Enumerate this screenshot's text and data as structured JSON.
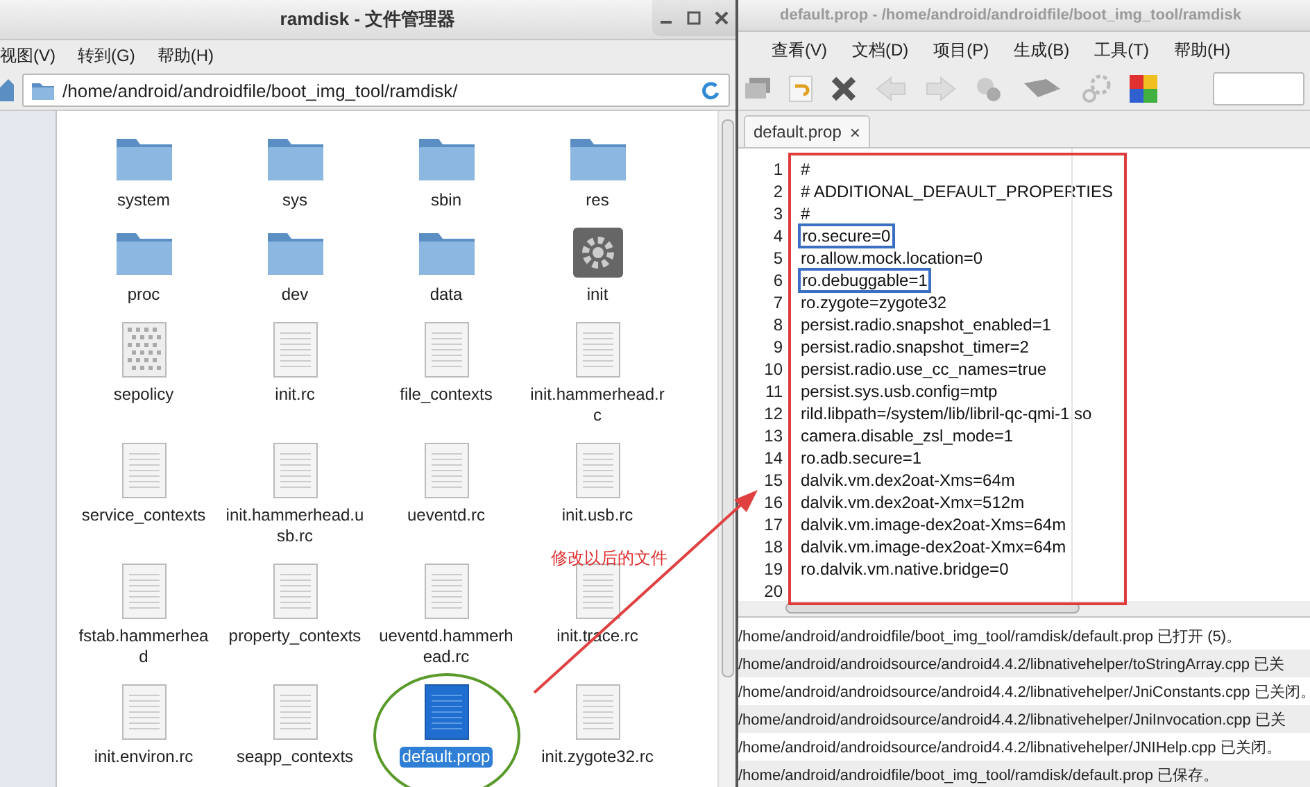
{
  "file_manager": {
    "title": "ramdisk - 文件管理器",
    "menu": [
      "视图(V)",
      "转到(G)",
      "帮助(H)"
    ],
    "path": "/home/android/androidfile/boot_img_tool/ramdisk/",
    "files": [
      {
        "name": "system",
        "kind": "folder",
        "selected": false
      },
      {
        "name": "sys",
        "kind": "folder",
        "selected": false
      },
      {
        "name": "sbin",
        "kind": "folder",
        "selected": false
      },
      {
        "name": "res",
        "kind": "folder",
        "selected": false
      },
      {
        "name": "proc",
        "kind": "folder",
        "selected": false
      },
      {
        "name": "dev",
        "kind": "folder",
        "selected": false
      },
      {
        "name": "data",
        "kind": "folder",
        "selected": false
      },
      {
        "name": "init",
        "kind": "program",
        "selected": false
      },
      {
        "name": "sepolicy",
        "kind": "binary",
        "selected": false
      },
      {
        "name": "init.rc",
        "kind": "text",
        "selected": false
      },
      {
        "name": "file_contexts",
        "kind": "text",
        "selected": false
      },
      {
        "name": "init.hammerhead.rc",
        "kind": "text",
        "selected": false
      },
      {
        "name": "service_contexts",
        "kind": "text",
        "selected": false
      },
      {
        "name": "init.hammerhead.usb.rc",
        "kind": "text",
        "selected": false
      },
      {
        "name": "ueventd.rc",
        "kind": "text",
        "selected": false
      },
      {
        "name": "init.usb.rc",
        "kind": "text",
        "selected": false
      },
      {
        "name": "fstab.hammerhead",
        "kind": "text",
        "selected": false
      },
      {
        "name": "property_contexts",
        "kind": "text",
        "selected": false
      },
      {
        "name": "ueventd.hammerhead.rc",
        "kind": "text",
        "selected": false
      },
      {
        "name": "init.trace.rc",
        "kind": "text",
        "selected": false
      },
      {
        "name": "init.environ.rc",
        "kind": "text",
        "selected": false
      },
      {
        "name": "seapp_contexts",
        "kind": "text",
        "selected": false
      },
      {
        "name": "default.prop",
        "kind": "text",
        "selected": true
      },
      {
        "name": "init.zygote32.rc",
        "kind": "text",
        "selected": false
      }
    ],
    "annotation": "修改以后的文件"
  },
  "editor": {
    "title": "default.prop - /home/android/androidfile/boot_img_tool/ramdisk",
    "menu": [
      "查看(V)",
      "文档(D)",
      "项目(P)",
      "生成(B)",
      "工具(T)",
      "帮助(H)"
    ],
    "tab": {
      "label": "default.prop",
      "close": "×"
    },
    "lines": [
      {
        "number": "1",
        "text": "#",
        "boxed": false
      },
      {
        "number": "2",
        "text": "# ADDITIONAL_DEFAULT_PROPERTIES",
        "boxed": false
      },
      {
        "number": "3",
        "text": "#",
        "boxed": false
      },
      {
        "number": "4",
        "text": "ro.secure=0",
        "boxed": true
      },
      {
        "number": "5",
        "text": "ro.allow.mock.location=0",
        "boxed": false
      },
      {
        "number": "6",
        "text": "ro.debuggable=1",
        "boxed": true
      },
      {
        "number": "7",
        "text": "ro.zygote=zygote32",
        "boxed": false
      },
      {
        "number": "8",
        "text": "persist.radio.snapshot_enabled=1",
        "boxed": false
      },
      {
        "number": "9",
        "text": "persist.radio.snapshot_timer=2",
        "boxed": false
      },
      {
        "number": "10",
        "text": "persist.radio.use_cc_names=true",
        "boxed": false
      },
      {
        "number": "11",
        "text": "persist.sys.usb.config=mtp",
        "boxed": false
      },
      {
        "number": "12",
        "text": "rild.libpath=/system/lib/libril-qc-qmi-1.so",
        "boxed": false
      },
      {
        "number": "13",
        "text": "camera.disable_zsl_mode=1",
        "boxed": false
      },
      {
        "number": "14",
        "text": "ro.adb.secure=1",
        "boxed": false
      },
      {
        "number": "15",
        "text": "dalvik.vm.dex2oat-Xms=64m",
        "boxed": false
      },
      {
        "number": "16",
        "text": "dalvik.vm.dex2oat-Xmx=512m",
        "boxed": false
      },
      {
        "number": "17",
        "text": "dalvik.vm.image-dex2oat-Xms=64m",
        "boxed": false
      },
      {
        "number": "18",
        "text": "dalvik.vm.image-dex2oat-Xmx=64m",
        "boxed": false
      },
      {
        "number": "19",
        "text": "ro.dalvik.vm.native.bridge=0",
        "boxed": false
      },
      {
        "number": "20"
      }
    ],
    "messages": [
      "/home/android/androidfile/boot_img_tool/ramdisk/default.prop 已打开 (5)。",
      "/home/android/androidsource/android4.4.2/libnativehelper/toStringArray.cpp 已关",
      "/home/android/androidsource/android4.4.2/libnativehelper/JniConstants.cpp 已关闭。",
      "/home/android/androidsource/android4.4.2/libnativehelper/JniInvocation.cpp 已关",
      "/home/android/androidsource/android4.4.2/libnativehelper/JNIHelp.cpp 已关闭。",
      "/home/android/androidfile/boot_img_tool/ramdisk/default.prop 已保存。"
    ]
  }
}
